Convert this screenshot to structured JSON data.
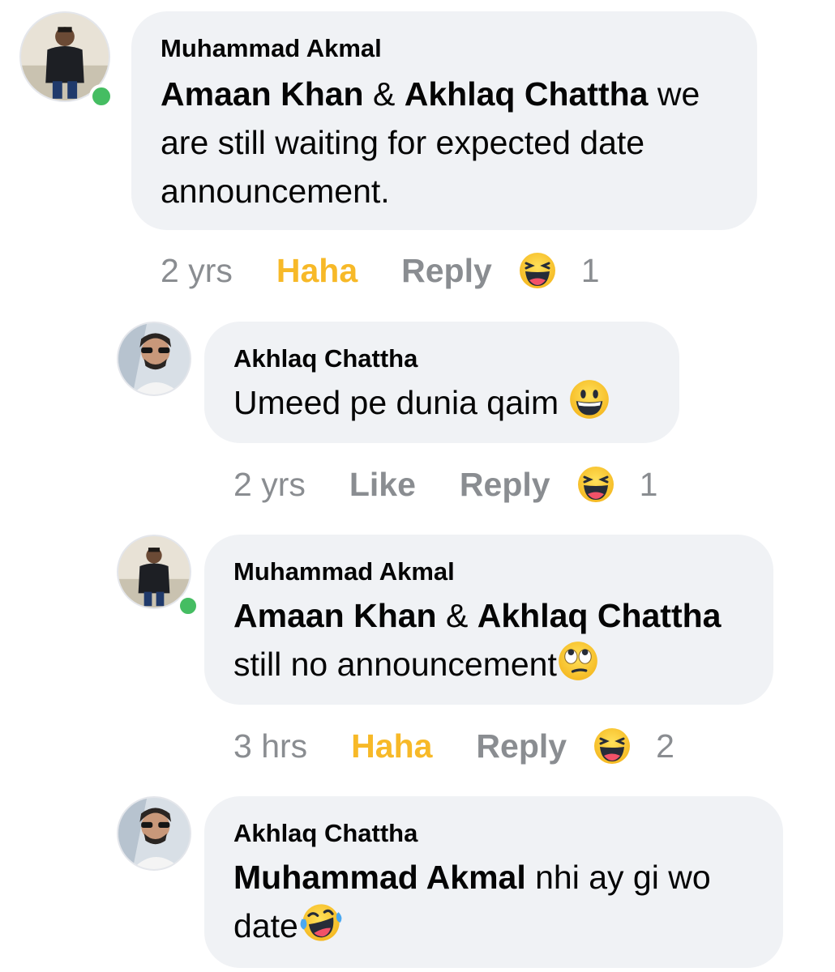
{
  "comments": [
    {
      "author": "Muhammad Akmal",
      "mentions": [
        "Amaan Khan",
        "Akhlaq Chattha"
      ],
      "joiner": " & ",
      "text": " we are still waiting for expected date announcement.",
      "time": "2 yrs",
      "action": "Haha",
      "reply": "Reply",
      "reaction": "haha-emoji",
      "count": "1",
      "online": true
    },
    {
      "author": "Akhlaq Chattha",
      "text": "Umeed pe dunia qaim ",
      "text_emoji": "grinning-emoji",
      "time": "2 yrs",
      "action": "Like",
      "reply": "Reply",
      "reaction": "haha-emoji",
      "count": "1",
      "online": false
    },
    {
      "author": "Muhammad Akmal",
      "mentions": [
        "Amaan Khan",
        "Akhlaq Chattha"
      ],
      "joiner": " & ",
      "text": "still no announcement",
      "text_emoji": "eye-roll-emoji",
      "time": "3 hrs",
      "action": "Haha",
      "reply": "Reply",
      "reaction": "haha-emoji",
      "count": "2",
      "online": true
    },
    {
      "author": "Akhlaq Chattha",
      "mentions": [
        "Muhammad Akmal"
      ],
      "text": " nhi ay gi wo date",
      "text_emoji": "tears-of-joy-emoji",
      "online": false
    }
  ],
  "colors": {
    "bubble": "#f0f2f5",
    "meta_gray": "#8a8d91",
    "haha_active": "#f7b928",
    "online": "#45bd62"
  }
}
